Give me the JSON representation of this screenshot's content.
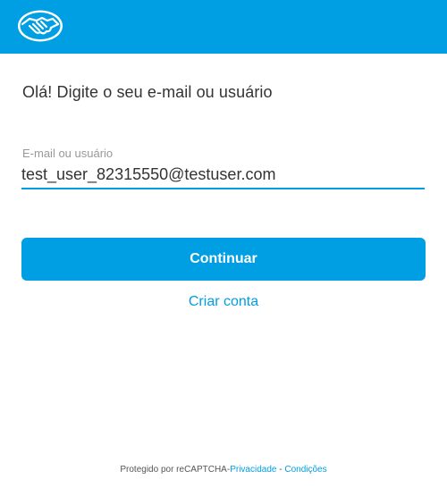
{
  "header": {
    "logo_icon": "mercadopago-handshake-logo-icon",
    "background_color": "#009ee3"
  },
  "login": {
    "title": "Olá! Digite o seu e-mail ou usuário",
    "field_label": "E-mail ou usuário",
    "field_value": "test_user_82315550@testuser.com",
    "continue_label": "Continuar",
    "create_account_label": "Criar conta"
  },
  "footer": {
    "protected_text": "Protegido por reCAPTCHA",
    "separator_1": "-",
    "privacy_label": "Privacidade",
    "separator_2": " - ",
    "terms_label": "Condições"
  },
  "colors": {
    "accent": "#009ee3",
    "title_text": "#333333",
    "label_text": "#999999"
  }
}
